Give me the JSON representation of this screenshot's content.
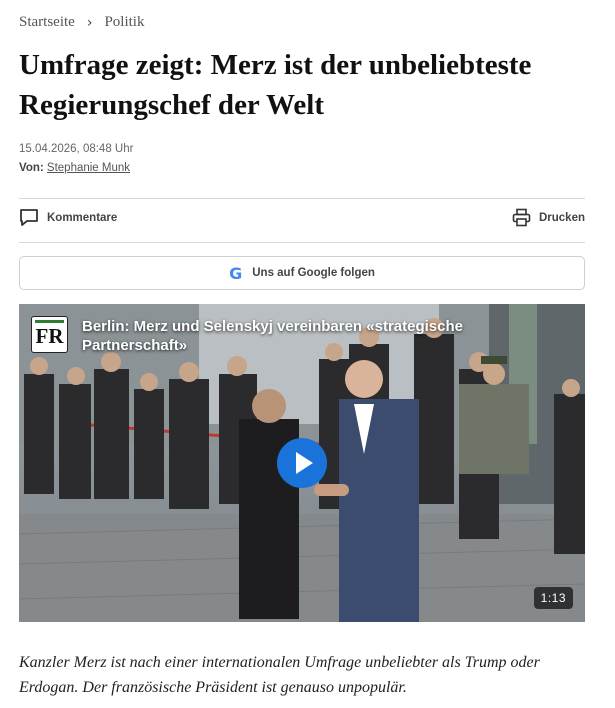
{
  "breadcrumb": {
    "home": "Startseite",
    "separator": "›",
    "section": "Politik"
  },
  "article": {
    "title": "Umfrage zeigt: Merz ist der unbeliebteste Regierungschef der Welt",
    "date": "15.04.2026, 08:48 Uhr",
    "author_prefix": "Von:",
    "author": "Stephanie Munk",
    "lead": "Kanzler Merz ist nach einer internationalen Umfrage unbeliebter als Trump oder Erdogan. Der französische Präsident ist genauso unpopulär."
  },
  "actions": {
    "comments": "Kommentare",
    "print": "Drucken"
  },
  "google_follow": {
    "icon": "G",
    "label": "Uns auf Google folgen"
  },
  "video": {
    "logo": "FR",
    "title": "Berlin: Merz und Selenskyj vereinbaren «strategische Partnerschaft»",
    "duration": "1:13"
  },
  "icons": {
    "comments": "speech-bubble-icon",
    "print": "printer-icon",
    "google": "google-g-icon",
    "play": "play-icon"
  },
  "colors": {
    "play_button": "#1a73d9",
    "logo_bar": "#2e7d32"
  }
}
